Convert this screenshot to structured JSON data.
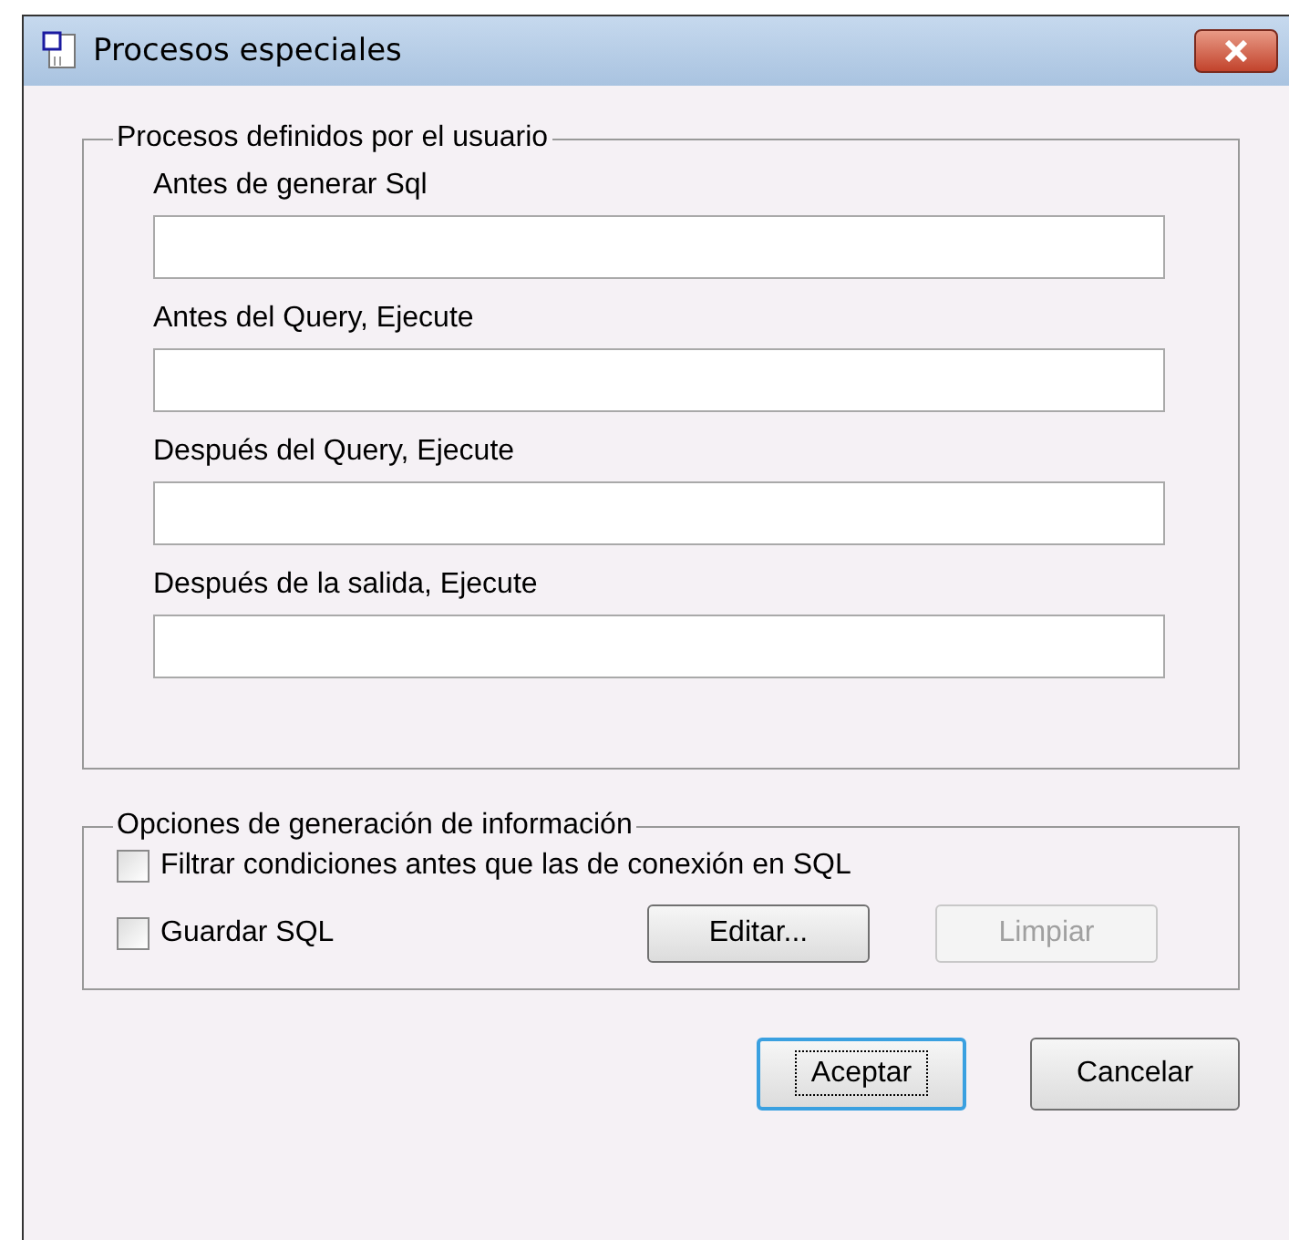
{
  "window": {
    "title": "Procesos especiales"
  },
  "user_processes": {
    "title": "Procesos definidos por el usuario",
    "fields": [
      {
        "label": "Antes de generar Sql"
      },
      {
        "label": "Antes del Query, Ejecute"
      },
      {
        "label": "Después del Query, Ejecute"
      },
      {
        "label": "Después de la salida, Ejecute"
      }
    ]
  },
  "options": {
    "title": "Opciones de generación de información",
    "checkboxes": [
      {
        "label": "Filtrar condiciones antes que las de conexión en SQL",
        "checked": false
      },
      {
        "label": "Guardar SQL",
        "checked": false
      }
    ],
    "buttons": [
      {
        "label": "Editar...",
        "disabled": false
      },
      {
        "label": "Limpiar",
        "disabled": true
      }
    ]
  },
  "buttons": [
    {
      "label": "Aceptar",
      "focused": true
    },
    {
      "label": "Cancelar",
      "focused": false
    }
  ]
}
